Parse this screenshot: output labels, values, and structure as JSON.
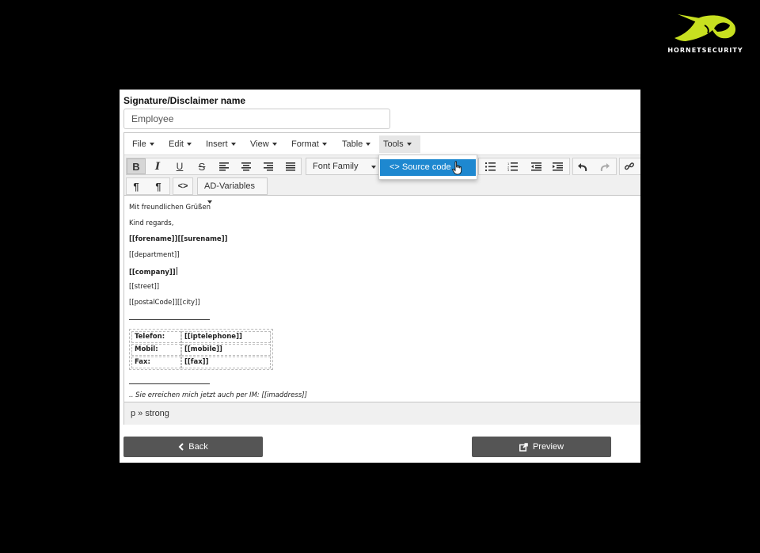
{
  "logo": {
    "text": "HORNETSECURITY",
    "color": "#c8e020"
  },
  "form": {
    "name_label": "Signature/Disclaimer name",
    "name_value": "Employee"
  },
  "menubar": {
    "file": "File",
    "edit": "Edit",
    "insert": "Insert",
    "view": "View",
    "format": "Format",
    "table": "Table",
    "tools": "Tools"
  },
  "toolbar": {
    "font_family": "Font Family",
    "ad_variables": "AD-Variables",
    "code_glyph": "<>",
    "pilcrow": "¶"
  },
  "tools_menu": {
    "source_code": "<> Source code"
  },
  "content": {
    "l1": "Mit freundlichen Grüßen",
    "l2": "Kind regards,",
    "l3": "[[forename]][[surename]]",
    "l4": "[[department]]",
    "l5": "[[company]]",
    "l6": "[[street]]",
    "l7": "[[postalCode]][[city]]",
    "table": [
      {
        "label": "Telefon:",
        "value": "[[iptelephone]]"
      },
      {
        "label": "Mobil:",
        "value": "[[mobile]]"
      },
      {
        "label": "Fax:",
        "value": "[[fax]]"
      }
    ],
    "im_line": ".. Sie erreichen mich jetzt auch per IM: [[imaddress]]"
  },
  "statusbar": {
    "path": "p » strong"
  },
  "buttons": {
    "back": "Back",
    "preview": "Preview"
  },
  "colors": {
    "accent": "#1e88d0",
    "button_bg": "#555555"
  }
}
